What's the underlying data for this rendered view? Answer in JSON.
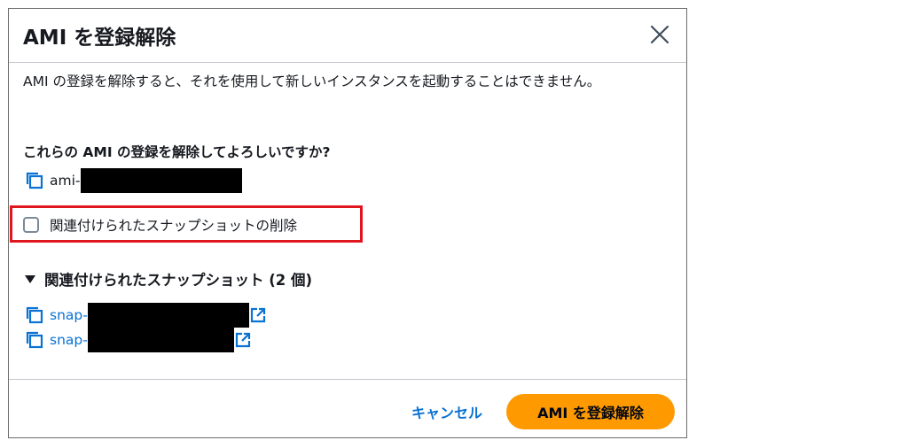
{
  "modal": {
    "title": "AMI を登録解除",
    "description": "AMI の登録を解除すると、それを使用して新しいインスタンスを起動することはできません。",
    "question": "これらの AMI の登録を解除してよろしいですか?",
    "ami_id_prefix": "ami-",
    "checkbox_label": "関連付けられたスナップショットの削除",
    "checkbox_checked": false,
    "snapshots_section": {
      "label": "関連付けられたスナップショット (2 個)",
      "expanded": true,
      "items": [
        {
          "id_prefix": "snap-"
        },
        {
          "id_prefix": "snap-"
        }
      ]
    },
    "footer": {
      "cancel_label": "キャンセル",
      "confirm_label": "AMI を登録解除"
    }
  },
  "colors": {
    "accent_link": "#0972d3",
    "primary_button": "#ff9900",
    "highlight": "#e0161f",
    "redaction": "#000000"
  },
  "icons": {
    "close": "close-icon",
    "copy": "copy-icon",
    "external_link": "external-link-icon",
    "caret": "caret-down-icon"
  }
}
